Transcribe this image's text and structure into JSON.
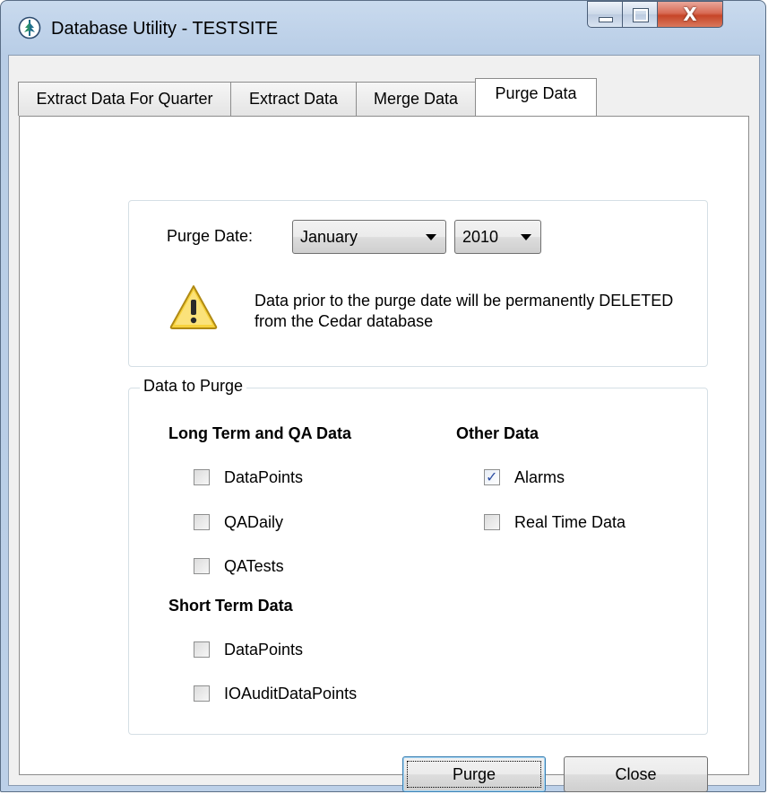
{
  "window": {
    "title": "Database Utility - TESTSITE",
    "close_glyph": "X"
  },
  "tabs": [
    {
      "label": "Extract Data For Quarter",
      "active": false
    },
    {
      "label": "Extract Data",
      "active": false
    },
    {
      "label": "Merge Data",
      "active": false
    },
    {
      "label": "Purge Data",
      "active": true
    }
  ],
  "purge_date": {
    "label": "Purge Date:",
    "month": "January",
    "year": "2010",
    "warning": "Data prior to the purge date will be permanently DELETED from the Cedar database",
    "warning_icon": "warning-icon"
  },
  "data_to_purge": {
    "legend": "Data to Purge",
    "long_term": {
      "heading": "Long Term and QA Data",
      "items": [
        {
          "label": "DataPoints",
          "checked": false
        },
        {
          "label": "QADaily",
          "checked": false
        },
        {
          "label": "QATests",
          "checked": false
        }
      ]
    },
    "short_term": {
      "heading": "Short Term Data",
      "items": [
        {
          "label": "DataPoints",
          "checked": false
        },
        {
          "label": "IOAuditDataPoints",
          "checked": false
        }
      ]
    },
    "other": {
      "heading": "Other Data",
      "items": [
        {
          "label": "Alarms",
          "checked": true
        },
        {
          "label": "Real Time Data",
          "checked": false
        }
      ]
    }
  },
  "buttons": {
    "purge": "Purge",
    "close": "Close"
  },
  "colors": {
    "title_bar": "#b8cde6",
    "check_mark": "#2c4ea3",
    "warning_yellow": "#f7d23c"
  }
}
